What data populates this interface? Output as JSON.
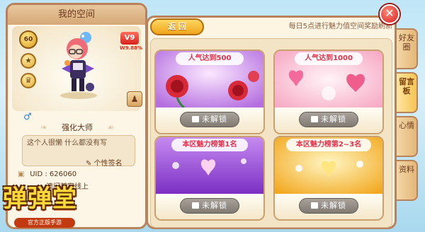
{
  "left_panel": {
    "title": "我的空间",
    "level": "60",
    "vip": {
      "label": "V9",
      "percent": "W9.88%"
    },
    "name": "强化大师",
    "signature": "这个人很懒 什么都没有写",
    "signature_edit_label": "个性签名",
    "uid_label": "UID",
    "uid_value": "626060",
    "location": "澳门首家线上"
  },
  "logo": {
    "title": "弹弹堂",
    "subtitle": "官方正版手游"
  },
  "main": {
    "back_label": "返 回",
    "refresh_note": "每日5点进行魅力值空间奖励刷新",
    "cards": [
      {
        "title": "人气达到500",
        "lock_label": "未解锁"
      },
      {
        "title": "人气达到1000",
        "lock_label": "未解锁"
      },
      {
        "title": "本区魅力榜第1名",
        "lock_label": "未解锁"
      },
      {
        "title": "本区魅力榜第2~3名",
        "lock_label": "未解锁"
      }
    ]
  },
  "side_tabs": [
    {
      "label": "好友圈",
      "active": false
    },
    {
      "label": "留言板",
      "active": true
    },
    {
      "label": "心情",
      "active": false
    },
    {
      "label": "资料",
      "active": false
    }
  ],
  "close_label": "✕",
  "colors": {
    "panel_border": "#b9825a",
    "accent_orange": "#f0a51a",
    "close_red": "#d81f1c",
    "card_title_red": "#e2324a"
  },
  "icons": [
    "gender-male-icon",
    "add-friend-icon",
    "lock-icon",
    "edit-icon",
    "close-icon"
  ]
}
